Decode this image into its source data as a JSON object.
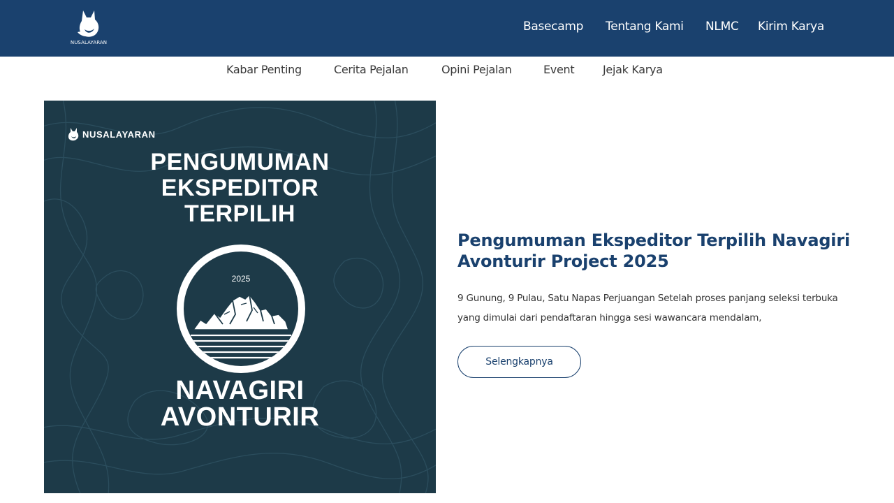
{
  "brand": {
    "logo_text": "NUSALAYARAN"
  },
  "main_nav": [
    "Basecamp",
    "Tentang Kami",
    "NLMC",
    "Kirim Karya"
  ],
  "sub_nav": [
    "Kabar Penting",
    "Cerita Pejalan",
    "Opini Pejalan",
    "Event",
    "Jejak Karya"
  ],
  "poster": {
    "brand": "NUSALAYARAN",
    "title_lines": [
      "PENGUMUMAN",
      "EKSPEDITOR",
      "TERPILIH"
    ],
    "year": "2025",
    "name_lines": [
      "NAVAGIRI",
      "AVONTURIR"
    ]
  },
  "article": {
    "title": "Pengumuman Ekspeditor Terpilih Navagiri Avonturir Project 2025",
    "excerpt": "9 Gunung, 9 Pulau, Satu Napas Perjuangan Setelah proses panjang seleksi terbuka yang dimulai dari pendaftaran hingga sesi wawancara mendalam,",
    "read_more": "Selengkapnya"
  },
  "colors": {
    "header_bg": "#1a416e",
    "poster_bg": "#1d3a48",
    "accent": "#1a416e",
    "text": "#333333"
  },
  "icons": {
    "logo": "fox-icon",
    "poster_logo": "fox-icon"
  }
}
